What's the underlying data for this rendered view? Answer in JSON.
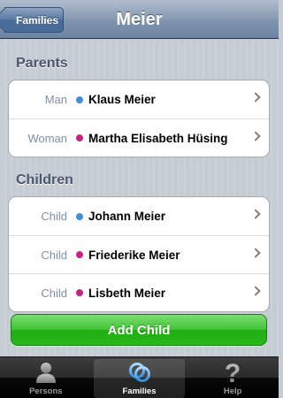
{
  "nav": {
    "back_label": "Families",
    "title": "Meier"
  },
  "sections": {
    "parents": {
      "header": "Parents",
      "rows": [
        {
          "label": "Man",
          "name": "Klaus Meier",
          "gender": "male"
        },
        {
          "label": "Woman",
          "name": "Martha Elisabeth Hüsing",
          "gender": "female"
        }
      ]
    },
    "children": {
      "header": "Children",
      "rows": [
        {
          "label": "Child",
          "name": "Johann Meier",
          "gender": "male"
        },
        {
          "label": "Child",
          "name": "Friederike Meier",
          "gender": "female"
        },
        {
          "label": "Child",
          "name": "Lisbeth Meier",
          "gender": "female"
        }
      ]
    }
  },
  "add_child_label": "Add Child",
  "tabbar": {
    "tabs": [
      {
        "label": "Persons",
        "icon": "person-icon",
        "selected": false
      },
      {
        "label": "Families",
        "icon": "rings-icon",
        "selected": true
      },
      {
        "label": "Help",
        "icon": "question-icon",
        "selected": false
      }
    ]
  },
  "colors": {
    "male": "#3e8fd6",
    "female": "#c5247f",
    "nav_bar": "#6d84a2",
    "add_button": "#28b81c",
    "background": "#c5ccd4"
  }
}
